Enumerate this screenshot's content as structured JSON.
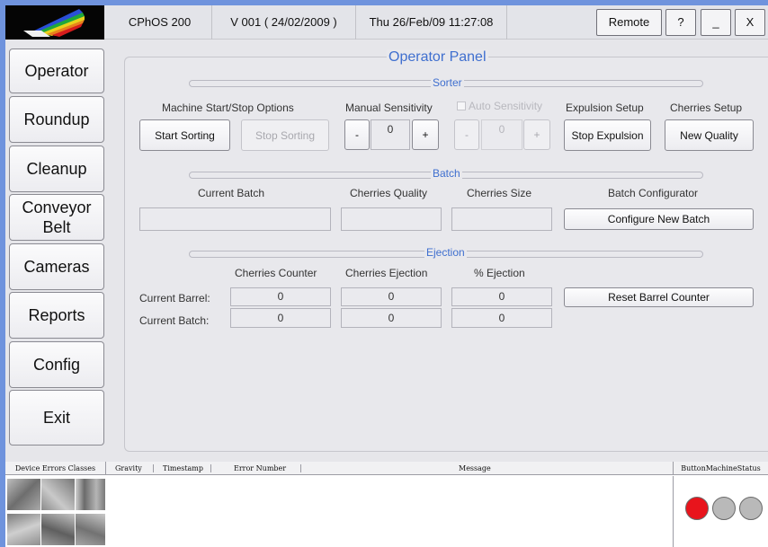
{
  "titlebar": {
    "app_name": "CPhOS 200",
    "version": "V 001 ( 24/02/2009 )",
    "datetime": "Thu 26/Feb/09 11:27:08",
    "remote_label": "Remote",
    "help_label": "?",
    "minimize_label": "_",
    "close_label": "X"
  },
  "sidebar": {
    "items": [
      {
        "label": "Operator"
      },
      {
        "label": "Roundup"
      },
      {
        "label": "Cleanup"
      },
      {
        "label": "Conveyor Belt"
      },
      {
        "label": "Cameras"
      },
      {
        "label": "Reports"
      },
      {
        "label": "Config"
      },
      {
        "label": "Exit"
      }
    ]
  },
  "panel": {
    "title": "Operator Panel",
    "sorter": {
      "title": "Sorter",
      "machine_label": "Machine Start/Stop Options",
      "start_sorting": "Start Sorting",
      "stop_sorting": "Stop Sorting",
      "manual_label": "Manual Sensitivity",
      "manual_minus": "-",
      "manual_value": "0",
      "manual_plus": "+",
      "auto_label": "Auto Sensitivity",
      "auto_minus": "-",
      "auto_value": "0",
      "auto_plus": "+",
      "expulsion_label": "Expulsion Setup",
      "stop_expulsion": "Stop Expulsion",
      "cherries_setup_label": "Cherries Setup",
      "new_quality": "New Quality"
    },
    "batch": {
      "title": "Batch",
      "current_batch_label": "Current Batch",
      "quality_label": "Cherries Quality",
      "size_label": "Cherries Size",
      "configurator_label": "Batch Configurator",
      "configure_button": "Configure New Batch",
      "current_batch_value": "",
      "quality_value": "",
      "size_value": ""
    },
    "ejection": {
      "title": "Ejection",
      "counter_label": "Cherries Counter",
      "ejection_label": "Cherries Ejection",
      "percent_label": "% Ejection",
      "barrel_label": "Current Barrel:",
      "batch_label": "Current Batch:",
      "barrel": {
        "counter": "0",
        "ejection": "0",
        "percent": "0"
      },
      "batch": {
        "counter": "0",
        "ejection": "0",
        "percent": "0"
      },
      "reset_button": "Reset Barrel Counter"
    }
  },
  "bottom": {
    "device_errors_header": "Device Errors Classes",
    "columns": [
      "Gravity",
      "Timestamp",
      "Error Number",
      "Message"
    ],
    "status_header": "ButtonMachineStatus",
    "status_colors": [
      "#e8141c",
      "#b9b9b9",
      "#b9b9b9"
    ]
  }
}
